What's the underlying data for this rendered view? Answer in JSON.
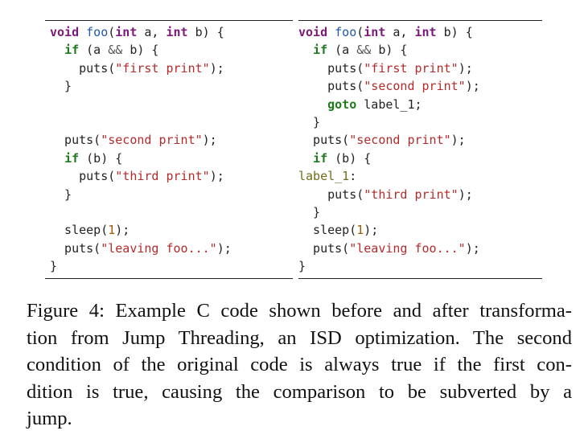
{
  "figure": {
    "left_code": [
      [
        {
          "t": "void",
          "c": "kw-type"
        },
        {
          "t": " "
        },
        {
          "t": "foo",
          "c": "fn"
        },
        {
          "t": "("
        },
        {
          "t": "int",
          "c": "kw-type"
        },
        {
          "t": " a, "
        },
        {
          "t": "int",
          "c": "kw-type"
        },
        {
          "t": " b) {"
        }
      ],
      [
        {
          "t": "  "
        },
        {
          "t": "if",
          "c": "kw"
        },
        {
          "t": " (a "
        },
        {
          "t": "&&",
          "c": "op"
        },
        {
          "t": " b) {"
        }
      ],
      [
        {
          "t": "    puts("
        },
        {
          "t": "\"first print\"",
          "c": "str"
        },
        {
          "t": ");"
        }
      ],
      [
        {
          "t": "  }"
        }
      ],
      [],
      [],
      [
        {
          "t": "  puts("
        },
        {
          "t": "\"second print\"",
          "c": "str"
        },
        {
          "t": ");"
        }
      ],
      [
        {
          "t": "  "
        },
        {
          "t": "if",
          "c": "kw"
        },
        {
          "t": " (b) {"
        }
      ],
      [
        {
          "t": "    puts("
        },
        {
          "t": "\"third print\"",
          "c": "str"
        },
        {
          "t": ");"
        }
      ],
      [
        {
          "t": "  }"
        }
      ],
      [],
      [
        {
          "t": "  sleep("
        },
        {
          "t": "1",
          "c": "num"
        },
        {
          "t": ");"
        }
      ],
      [
        {
          "t": "  puts("
        },
        {
          "t": "\"leaving foo...\"",
          "c": "str"
        },
        {
          "t": ");"
        }
      ],
      [
        {
          "t": "}"
        }
      ]
    ],
    "right_code": [
      [
        {
          "t": "void",
          "c": "kw-type"
        },
        {
          "t": " "
        },
        {
          "t": "foo",
          "c": "fn"
        },
        {
          "t": "("
        },
        {
          "t": "int",
          "c": "kw-type"
        },
        {
          "t": " a, "
        },
        {
          "t": "int",
          "c": "kw-type"
        },
        {
          "t": " b) {"
        }
      ],
      [
        {
          "t": "  "
        },
        {
          "t": "if",
          "c": "kw"
        },
        {
          "t": " (a "
        },
        {
          "t": "&&",
          "c": "op"
        },
        {
          "t": " b) {"
        }
      ],
      [
        {
          "t": "    puts("
        },
        {
          "t": "\"first print\"",
          "c": "str"
        },
        {
          "t": ");"
        }
      ],
      [
        {
          "t": "    puts("
        },
        {
          "t": "\"second print\"",
          "c": "str"
        },
        {
          "t": ");"
        }
      ],
      [
        {
          "t": "    "
        },
        {
          "t": "goto",
          "c": "kw"
        },
        {
          "t": " label_1;"
        }
      ],
      [
        {
          "t": "  }"
        }
      ],
      [
        {
          "t": "  puts("
        },
        {
          "t": "\"second print\"",
          "c": "str"
        },
        {
          "t": ");"
        }
      ],
      [
        {
          "t": "  "
        },
        {
          "t": "if",
          "c": "kw"
        },
        {
          "t": " (b) {"
        }
      ],
      [
        {
          "t": "label_1",
          "c": "label"
        },
        {
          "t": ":"
        }
      ],
      [
        {
          "t": "    puts("
        },
        {
          "t": "\"third print\"",
          "c": "str"
        },
        {
          "t": ");"
        }
      ],
      [
        {
          "t": "  }"
        }
      ],
      [
        {
          "t": "  sleep("
        },
        {
          "t": "1",
          "c": "num"
        },
        {
          "t": ");"
        }
      ],
      [
        {
          "t": "  puts("
        },
        {
          "t": "\"leaving foo...\"",
          "c": "str"
        },
        {
          "t": ");"
        }
      ],
      [
        {
          "t": "}"
        }
      ]
    ],
    "caption_lines": [
      "Figure 4: Example C code shown before and after transforma-",
      "tion from Jump Threading, an ISD optimization. The second",
      "condition of the original code is always true if the first con-",
      "dition is true, causing the comparison to be subverted by a",
      "jump."
    ],
    "colors": {
      "keyword": "#1d7a1d",
      "type_keyword": "#7b1a7b",
      "function": "#1f58a8",
      "string": "#b52a2a",
      "number": "#a05a00",
      "label": "#6e6e1a"
    }
  }
}
